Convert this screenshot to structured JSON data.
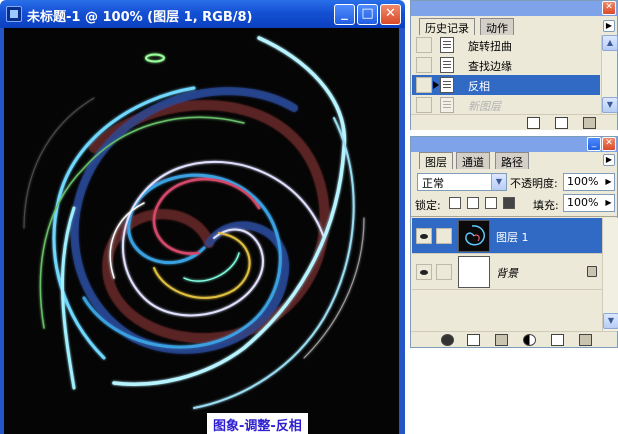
{
  "document": {
    "title": "未标题-1 @ 100% (图层 1, RGB/8)",
    "caption": "图象-调整-反相",
    "window_buttons": {
      "minimize": "_",
      "maximize": "□",
      "close": "✕"
    }
  },
  "history_panel": {
    "tabs": [
      {
        "label": "历史记录",
        "active": true
      },
      {
        "label": "动作",
        "active": false
      }
    ],
    "items": [
      {
        "label": "旋转扭曲",
        "state": "normal"
      },
      {
        "label": "查找边缘",
        "state": "normal"
      },
      {
        "label": "反相",
        "state": "selected"
      },
      {
        "label": "新图层",
        "state": "dimmed"
      }
    ],
    "footer_icons": [
      "new-document-icon",
      "snapshot-icon",
      "trash-icon"
    ]
  },
  "layers_panel": {
    "tabs": [
      {
        "label": "图层",
        "active": true
      },
      {
        "label": "通道",
        "active": false
      },
      {
        "label": "路径",
        "active": false
      }
    ],
    "blend_mode": "正常",
    "opacity_label": "不透明度:",
    "opacity_value": "100%",
    "lock_label": "锁定:",
    "fill_label": "填充:",
    "fill_value": "100%",
    "layers": [
      {
        "name": "图层 1",
        "selected": true,
        "locked": false
      },
      {
        "name": "背景",
        "selected": false,
        "locked": true
      }
    ],
    "footer_icons": [
      "link-icon",
      "layer-style-icon",
      "mask-icon",
      "group-icon",
      "adjustment-icon",
      "new-layer-icon",
      "trash-icon"
    ]
  },
  "colors": {
    "title_bar": "#1450d4",
    "selection": "#316ac5",
    "caption_text": "#2e1fd0",
    "canvas_bg": "#050505"
  }
}
